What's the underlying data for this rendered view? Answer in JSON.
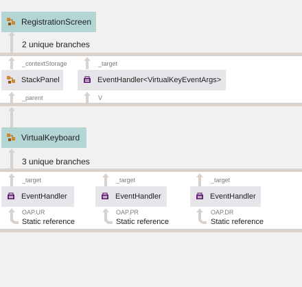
{
  "top_text": "",
  "group1": {
    "root": {
      "label": "RegistrationScreen",
      "icon": "class-icon"
    },
    "branches": "2 unique branches",
    "columns": [
      {
        "edge_label": "_contextStorage",
        "node_label": "StackPanel",
        "node_icon": "class-icon",
        "parent_label": "_parent"
      },
      {
        "edge_label": "_target",
        "node_label": "EventHandler<VirtualKeyEventArgs>",
        "node_icon": "delegate-icon",
        "parent_label": "V"
      }
    ]
  },
  "group2": {
    "root": {
      "label": "VirtualKeyboard",
      "icon": "class-icon"
    },
    "branches": "3 unique branches",
    "columns": [
      {
        "edge_label": "_target",
        "node_label": "EventHandler",
        "node_icon": "delegate-icon",
        "field_label": "OAP.UR",
        "ref_label": "Static reference"
      },
      {
        "edge_label": "_target",
        "node_label": "EventHandler",
        "node_icon": "delegate-icon",
        "field_label": "OAP.PR",
        "ref_label": "Static reference"
      },
      {
        "edge_label": "_target",
        "node_label": "EventHandler",
        "node_icon": "delegate-icon",
        "field_label": "OAP.DR",
        "ref_label": "Static reference"
      }
    ]
  },
  "colors": {
    "root_node": "#b3d5d3",
    "child_node": "#e6e6ea",
    "connector": "#d9d2cc",
    "class_icon": "#d0892a",
    "delegate_icon": "#68217a"
  }
}
